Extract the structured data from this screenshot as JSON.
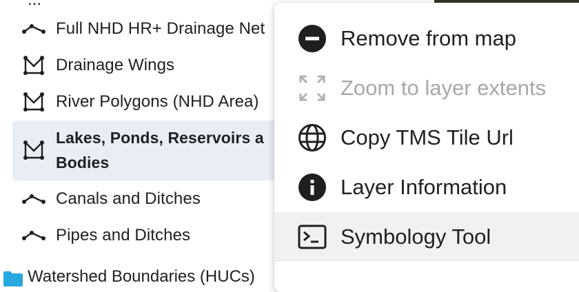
{
  "layers": {
    "top_partial": "...",
    "items": [
      {
        "label": "Full NHD HR+ Drainage Net",
        "icon": "line-icon"
      },
      {
        "label": "Drainage Wings",
        "icon": "polygon-icon"
      },
      {
        "label": "River Polygons (NHD Area)",
        "icon": "polygon-icon"
      },
      {
        "label": "Lakes, Ponds, Reservoirs a Bodies",
        "icon": "polygon-icon",
        "selected": true
      },
      {
        "label": "Canals and Ditches",
        "icon": "line-icon"
      },
      {
        "label": "Pipes and Ditches",
        "icon": "line-icon"
      }
    ],
    "folder": {
      "label": "Watershed Boundaries (HUCs)",
      "icon": "folder-icon",
      "color": "#29a8e0"
    }
  },
  "menu": {
    "items": [
      {
        "label": "Remove from map",
        "icon": "minus-circle-icon",
        "enabled": true
      },
      {
        "label": "Zoom to layer extents",
        "icon": "zoom-extents-icon",
        "enabled": false
      },
      {
        "label": "Copy TMS Tile Url",
        "icon": "globe-icon",
        "enabled": true
      },
      {
        "label": "Layer Information",
        "icon": "info-icon",
        "enabled": true
      },
      {
        "label": "Symbology Tool",
        "icon": "terminal-icon",
        "enabled": true,
        "hovered": true
      }
    ]
  },
  "colors": {
    "selected_bg": "#e9eef5",
    "icon_dark": "#1f1f1f",
    "disabled_text": "#a8a8a8",
    "folder": "#29a8e0"
  }
}
